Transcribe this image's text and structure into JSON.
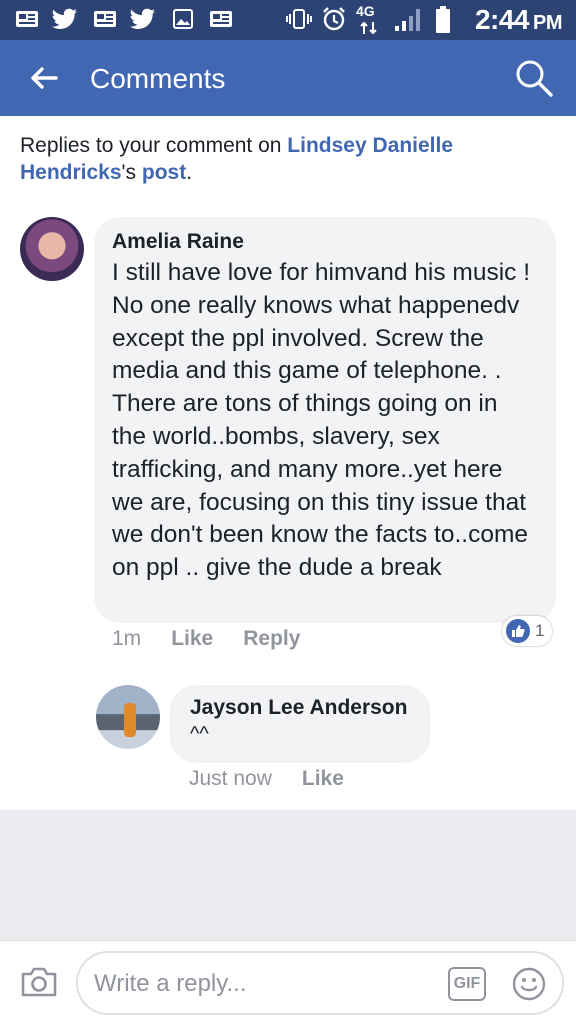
{
  "status_bar": {
    "time": "2:44",
    "ampm": "PM",
    "network": "4G"
  },
  "header": {
    "title": "Comments"
  },
  "intro": {
    "prefix": "Replies to your comment on ",
    "post_author": "Lindsey Danielle Hendricks",
    "possessive": "'s ",
    "post_link": "post",
    "suffix": "."
  },
  "comment": {
    "author": "Amelia Raine",
    "text": "I still have love for himvand his music ! No one really knows what happenedv except the ppl involved. Screw the media and this game of telephone. . There are tons of things going on in the world..bombs, slavery, sex trafficking, and many more..yet here we are, focusing on this tiny issue that we don't been know the facts to..come on ppl .. give the dude a break",
    "time": "1m",
    "like_label": "Like",
    "reply_label": "Reply",
    "reaction_count": "1"
  },
  "reply": {
    "author": "Jayson Lee Anderson",
    "text": "^^",
    "time": "Just now",
    "like_label": "Like"
  },
  "composer": {
    "placeholder": "Write a reply...",
    "gif_label": "GIF"
  },
  "colors": {
    "status_bar": "#2d4373",
    "header": "#4267b2",
    "link": "#4267b2",
    "bubble": "#f2f3f5",
    "meta": "#90949c"
  }
}
